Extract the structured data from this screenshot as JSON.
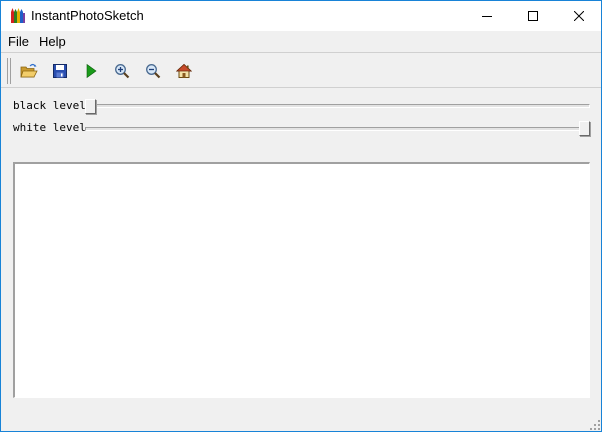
{
  "window": {
    "title": "InstantPhotoSketch",
    "app_icon": "crayons-icon"
  },
  "title_buttons": [
    "minimize-icon",
    "maximize-icon",
    "close-icon"
  ],
  "menu": {
    "file": "File",
    "help": "Help"
  },
  "toolbar": {
    "tools": [
      "open-folder-icon",
      "save-disk-icon",
      "run-play-icon",
      "zoom-in-icon",
      "zoom-out-icon",
      "home-icon"
    ]
  },
  "sliders": {
    "black": {
      "label": "black level",
      "value": 0
    },
    "white": {
      "label": "white level",
      "value": 1
    }
  },
  "colors": {
    "window_border": "#1883d7",
    "play_green": "#1a9b1a",
    "save_blue": "#2a4fb0",
    "folder_yellow": "#e8b84a"
  }
}
